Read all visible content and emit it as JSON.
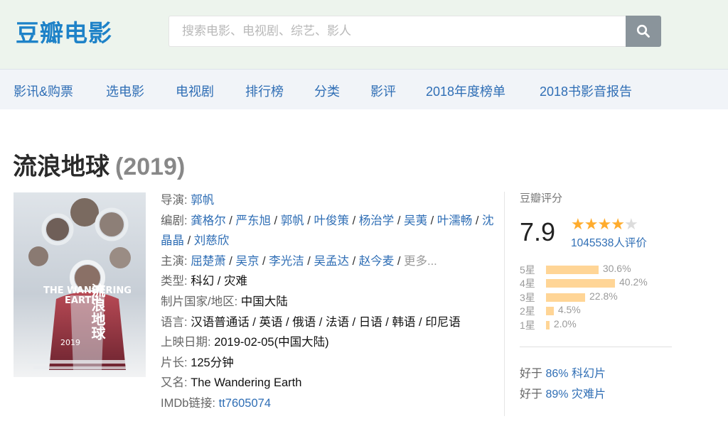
{
  "header": {
    "logo": "豆瓣电影",
    "search_placeholder": "搜索电影、电视剧、综艺、影人"
  },
  "nav": {
    "items": [
      "影讯&购票",
      "选电影",
      "电视剧",
      "排行榜",
      "分类",
      "影评",
      "2018年度榜单",
      "2018书影音报告"
    ]
  },
  "movie": {
    "title": "流浪地球",
    "year": "(2019)",
    "poster": {
      "title_en_1": "THE WANDERING",
      "title_en_2": "EARTH",
      "title_cn": "流浪地球",
      "date": "2019"
    },
    "info": {
      "director_label": "导演:",
      "director": "郭帆",
      "writer_label": "编剧:",
      "writers": [
        "龚格尔",
        "严东旭",
        "郭帆",
        "叶俊策",
        "杨治学",
        "吴荑",
        "叶濡畅",
        "沈晶晶",
        "刘慈欣"
      ],
      "cast_label": "主演:",
      "cast": [
        "屈楚萧",
        "吴京",
        "李光洁",
        "吴孟达",
        "赵今麦"
      ],
      "cast_more": "更多...",
      "genre_label": "类型:",
      "genre": "科幻 / 灾难",
      "country_label": "制片国家/地区:",
      "country": "中国大陆",
      "language_label": "语言:",
      "language": "汉语普通话 / 英语 / 俄语 / 法语 / 日语 / 韩语 / 印尼语",
      "release_label": "上映日期:",
      "release": "2019-02-05(中国大陆)",
      "runtime_label": "片长:",
      "runtime": "125分钟",
      "aka_label": "又名:",
      "aka": "The Wandering Earth",
      "imdb_label": "IMDb链接:",
      "imdb": "tt7605074"
    }
  },
  "rating": {
    "label": "豆瓣评分",
    "score": "7.9",
    "stars_filled": 4,
    "stars_total": 5,
    "votes": "1045538人评价",
    "distribution": [
      {
        "label": "5星",
        "pct": "30.6%",
        "value": 30.6
      },
      {
        "label": "4星",
        "pct": "40.2%",
        "value": 40.2
      },
      {
        "label": "3星",
        "pct": "22.8%",
        "value": 22.8
      },
      {
        "label": "2星",
        "pct": "4.5%",
        "value": 4.5
      },
      {
        "label": "1星",
        "pct": "2.0%",
        "value": 2.0
      }
    ],
    "better_than": [
      {
        "prefix": "好于",
        "link": "86% 科幻片"
      },
      {
        "prefix": "好于",
        "link": "89% 灾难片"
      }
    ]
  },
  "colors": {
    "link": "#2f6eb5",
    "logo": "#1e82c8",
    "star": "#ffac2d",
    "bar": "#ffd596"
  }
}
